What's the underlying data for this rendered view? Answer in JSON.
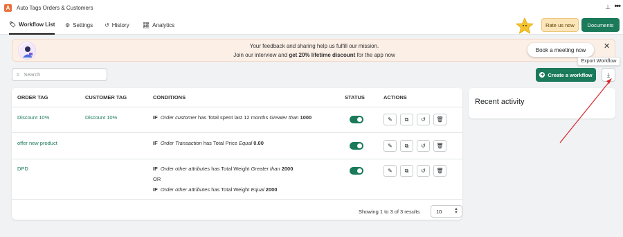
{
  "app": {
    "title": "Auto Tags Orders & Customers",
    "logo": "A"
  },
  "tabs": [
    {
      "label": "Workflow List",
      "icon": "tag-icon"
    },
    {
      "label": "Settings",
      "icon": "gear-icon"
    },
    {
      "label": "History",
      "icon": "history-icon"
    },
    {
      "label": "Analytics",
      "icon": "chart-icon"
    }
  ],
  "header_buttons": {
    "rate": "Rate us now",
    "docs": "Documents"
  },
  "banner": {
    "line1": "Your feedback and sharing help us fulfill our mission.",
    "line2_pre": "Join our interview and ",
    "line2_bold": "get 20% lifetime discount",
    "line2_post": " for the app now",
    "meeting_button": "Book a meeting now"
  },
  "search": {
    "placeholder": "Search",
    "value": ""
  },
  "toolbar": {
    "create_label": "Create a workflow",
    "export_tooltip": "Export Workflow"
  },
  "table": {
    "headers": [
      "ORDER TAG",
      "CUSTOMER TAG",
      "CONDITIONS",
      "STATUS",
      "ACTIONS"
    ],
    "if_keyword": "IF",
    "or_keyword": "OR",
    "rows": [
      {
        "order_tag": "Discount 10%",
        "customer_tag": "Discount 10%",
        "conditions": [
          {
            "subject": "Order customer",
            "text": "has Total spent last 12 months",
            "op": "Greater than",
            "value": "1000"
          }
        ],
        "enabled": true
      },
      {
        "order_tag": "offer new product",
        "customer_tag": "",
        "conditions": [
          {
            "subject": "Order Transaction",
            "text": "has Total Price",
            "op": "Equal",
            "value": "0.00"
          }
        ],
        "enabled": true
      },
      {
        "order_tag": "DPD",
        "customer_tag": "",
        "conditions": [
          {
            "subject": "Order other attributes",
            "text": "has Total Weight",
            "op": "Greater than",
            "value": "2000"
          },
          {
            "subject": "Order other attributes",
            "text": "has Total Weight",
            "op": "Equal",
            "value": "2000"
          }
        ],
        "enabled": true
      }
    ]
  },
  "pagination": {
    "summary": "Showing 1 to 3 of 3 results",
    "per_page": "10"
  },
  "recent": {
    "title": "Recent activity"
  },
  "colors": {
    "primary": "#1a7a5a",
    "rate_bg": "#fce5b8",
    "banner_bg": "#fcefe6",
    "annotation": "#d9262c"
  }
}
